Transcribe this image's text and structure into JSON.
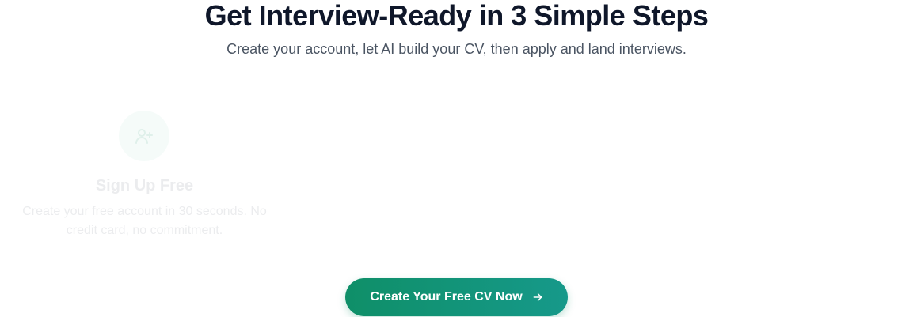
{
  "header": {
    "title": "Get Interview-Ready in 3 Simple Steps",
    "subtitle": "Create your account, let AI build your CV, then apply and land interviews."
  },
  "steps": [
    {
      "icon": "user-plus-icon",
      "title": "Sign Up Free",
      "description": "Create your free account in 30 seconds. No credit card, no commitment."
    }
  ],
  "cta": {
    "label": "Create Your Free CV Now",
    "icon": "arrow-right-icon"
  },
  "colors": {
    "heading": "#0f172a",
    "accent_start": "#0f8f68",
    "accent_end": "#16998a",
    "icon_bg": "#b7e4d3"
  }
}
